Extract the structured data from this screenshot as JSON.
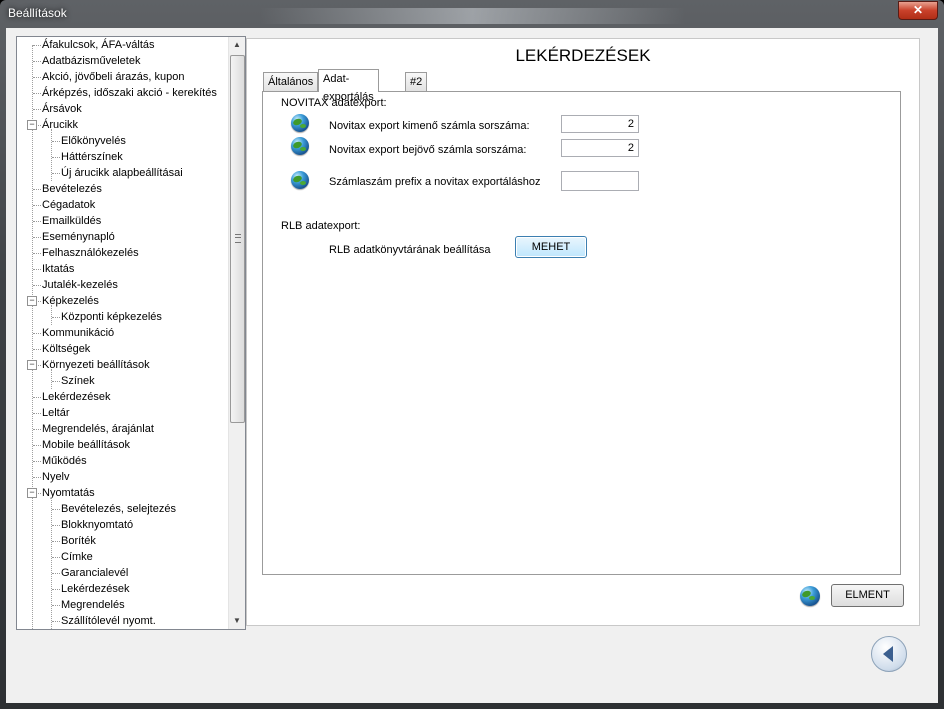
{
  "window": {
    "title": "Beállítások",
    "close_glyph": "✕"
  },
  "tree": {
    "items": [
      {
        "label": "Áfakulcsok, ÁFA-váltás",
        "level": 0
      },
      {
        "label": "Adatbázisműveletek",
        "level": 0
      },
      {
        "label": "Akció, jövőbeli árazás, kupon",
        "level": 0
      },
      {
        "label": "Árképzés, időszaki akció - kerekítés",
        "level": 0
      },
      {
        "label": "Ársávok",
        "level": 0
      },
      {
        "label": "Árucikk",
        "level": 0,
        "expander": "−"
      },
      {
        "label": "Előkönyvelés",
        "level": 1
      },
      {
        "label": "Háttérszínek",
        "level": 1
      },
      {
        "label": "Új árucikk alapbeállításai",
        "level": 1
      },
      {
        "label": "Bevételezés",
        "level": 0
      },
      {
        "label": "Cégadatok",
        "level": 0
      },
      {
        "label": "Emailküldés",
        "level": 0
      },
      {
        "label": "Eseménynapló",
        "level": 0
      },
      {
        "label": "Felhasználókezelés",
        "level": 0
      },
      {
        "label": "Iktatás",
        "level": 0
      },
      {
        "label": "Jutalék-kezelés",
        "level": 0
      },
      {
        "label": "Képkezelés",
        "level": 0,
        "expander": "−"
      },
      {
        "label": "Központi képkezelés",
        "level": 1
      },
      {
        "label": "Kommunikáció",
        "level": 0
      },
      {
        "label": "Költségek",
        "level": 0
      },
      {
        "label": "Környezeti beállítások",
        "level": 0,
        "expander": "−"
      },
      {
        "label": "Színek",
        "level": 1
      },
      {
        "label": "Lekérdezések",
        "level": 0
      },
      {
        "label": "Leltár",
        "level": 0
      },
      {
        "label": "Megrendelés, árajánlat",
        "level": 0
      },
      {
        "label": "Mobile beállítások",
        "level": 0
      },
      {
        "label": "Működés",
        "level": 0
      },
      {
        "label": "Nyelv",
        "level": 0
      },
      {
        "label": "Nyomtatás",
        "level": 0,
        "expander": "−"
      },
      {
        "label": "Bevételezés, selejtezés",
        "level": 1
      },
      {
        "label": "Blokknyomtató",
        "level": 1
      },
      {
        "label": "Boríték",
        "level": 1
      },
      {
        "label": "Címke",
        "level": 1
      },
      {
        "label": "Garancialevél",
        "level": 1
      },
      {
        "label": "Lekérdezések",
        "level": 1
      },
      {
        "label": "Megrendelés",
        "level": 1
      },
      {
        "label": "Szállítólevél nyomt.",
        "level": 1
      }
    ],
    "scroll_up_glyph": "▲",
    "scroll_down_glyph": "▼"
  },
  "panel": {
    "title": "LEKÉRDEZÉSEK",
    "tabs": [
      {
        "label": "Általános",
        "active": false
      },
      {
        "label": "Adat-exportálás",
        "active": true
      },
      {
        "label": "#2",
        "active": false
      }
    ],
    "novitax": {
      "section_label": "NOVITAX adatexport:",
      "rows": [
        {
          "label": "Novitax export kimenő számla sorszáma:",
          "value": "2",
          "icon": "globe-icon"
        },
        {
          "label": "Novitax export bejövő számla sorszáma:",
          "value": "2",
          "icon": "globe-icon"
        },
        {
          "label": "Számlaszám prefix a novitax exportáláshoz",
          "value": "",
          "icon": "globe-icon"
        }
      ]
    },
    "rlb": {
      "section_label": "RLB adatexport:",
      "row_label": "RLB adatkönyvtárának beállítása",
      "button_label": "MEHET"
    },
    "save_button_label": "ELMENT"
  }
}
